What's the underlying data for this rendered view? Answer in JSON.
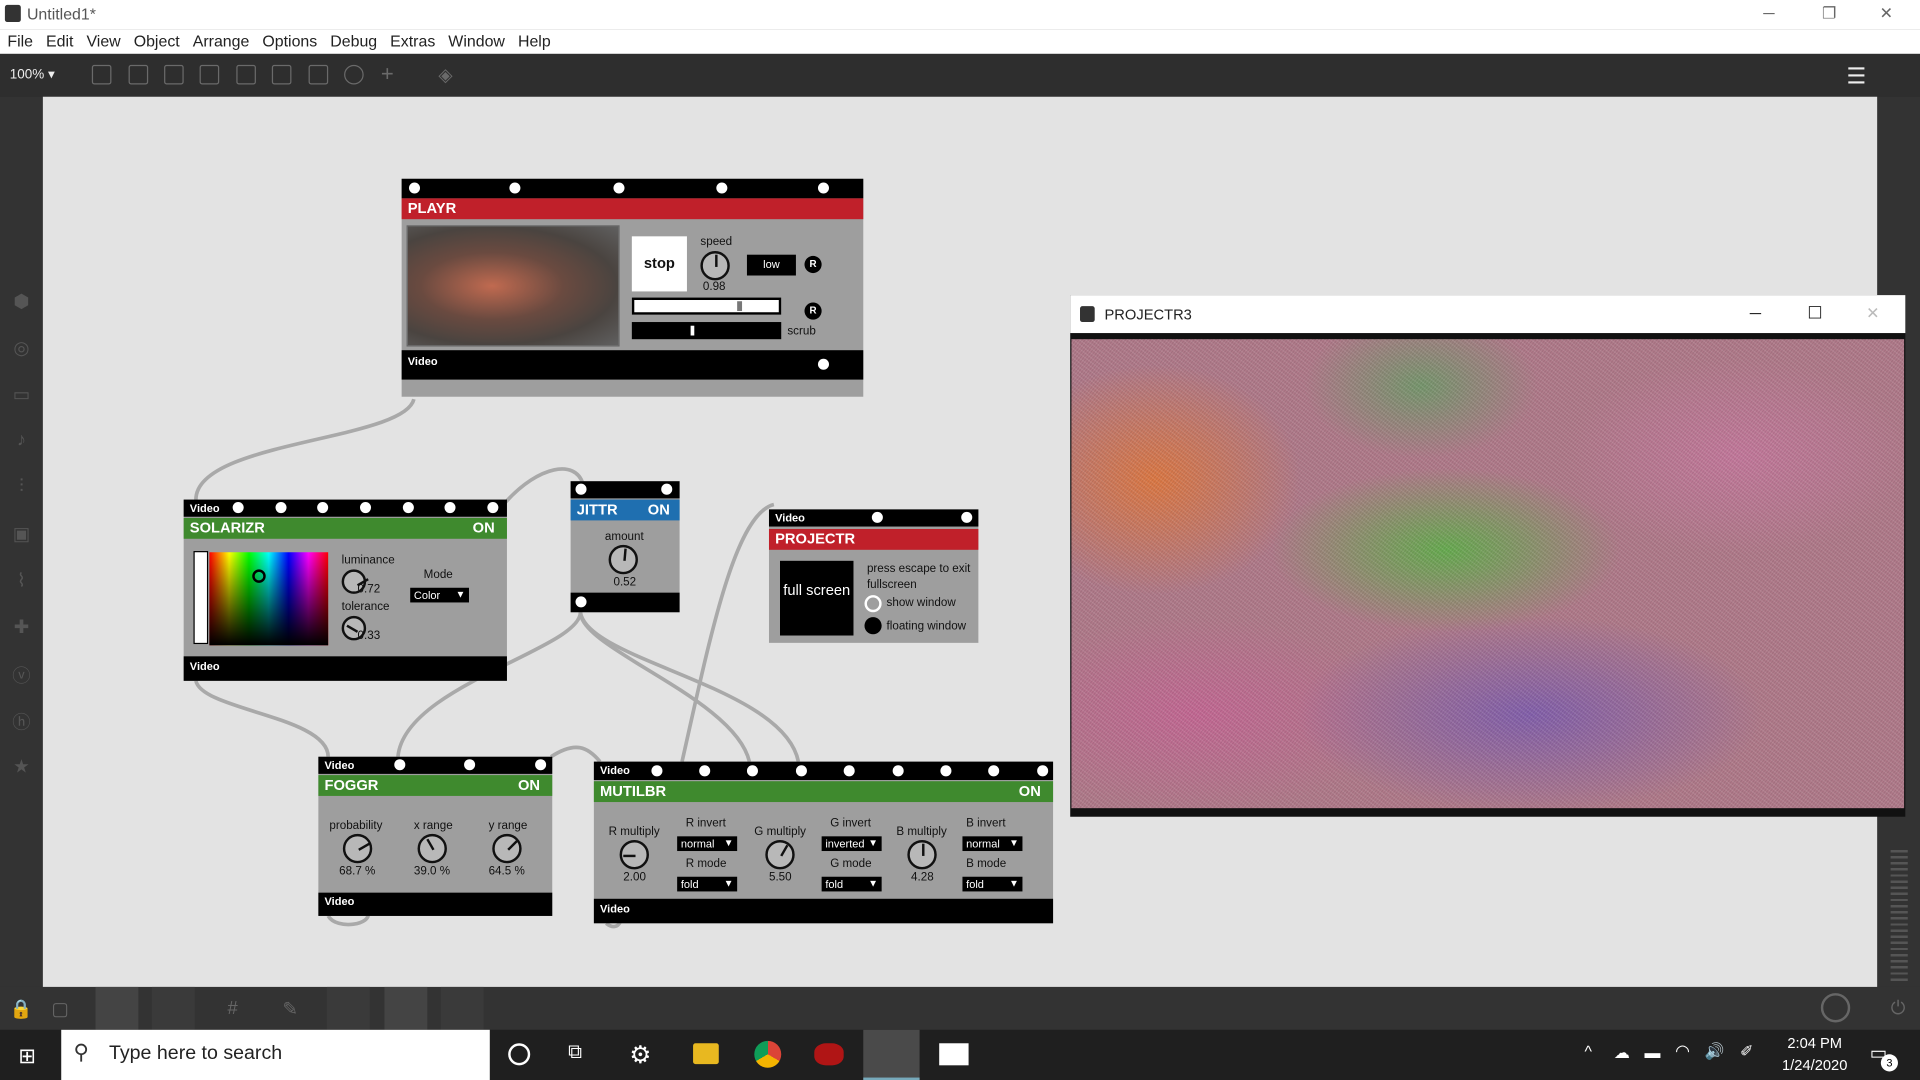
{
  "window": {
    "title": "Untitled1*",
    "minimize": "─",
    "restore": "❐",
    "close": "✕"
  },
  "menu": [
    "File",
    "Edit",
    "View",
    "Object",
    "Arrange",
    "Options",
    "Debug",
    "Extras",
    "Window",
    "Help"
  ],
  "toolbar": {
    "zoom": "100% ▾"
  },
  "playr": {
    "title": "PLAYR",
    "stop_label": "stop",
    "speed_label": "speed",
    "speed_value": "0.98",
    "speed_knob": 0.49,
    "quality_label": "low",
    "reset_label": "R",
    "scrub_label": "scrub",
    "out_label": "Video"
  },
  "solarizr": {
    "in_label": "Video",
    "title": "SOLARIZR",
    "state": "ON",
    "luminance_label": "luminance",
    "luminance_value": "0.72",
    "tolerance_label": "tolerance",
    "tolerance_value": "0.33",
    "mode_label": "Mode",
    "mode_value": "Color",
    "out_label": "Video"
  },
  "jittr": {
    "title": "JITTR",
    "state": "ON",
    "amount_label": "amount",
    "amount_value": "0.52"
  },
  "projectr": {
    "in_label": "Video",
    "title": "PROJECTR",
    "fullscreen_label": "full screen",
    "escape_text": "press escape to exit fullscreen",
    "show_window_label": "show window",
    "floating_window_label": "floating window"
  },
  "foggr": {
    "in_label": "Video",
    "title": "FOGGR",
    "state": "ON",
    "probability_label": "probability",
    "probability_value": "68.7 %",
    "xrange_label": "x range",
    "xrange_value": "39.0 %",
    "yrange_label": "y range",
    "yrange_value": "64.5 %",
    "out_label": "Video"
  },
  "mutilbr": {
    "in_label": "Video",
    "title": "MUTILBR",
    "state": "ON",
    "r_multiply_label": "R multiply",
    "r_multiply_value": "2.00",
    "r_invert_label": "R invert",
    "r_invert_value": "normal",
    "r_mode_label": "R mode",
    "r_mode_value": "fold",
    "g_multiply_label": "G multiply",
    "g_multiply_value": "5.50",
    "g_invert_label": "G invert",
    "g_invert_value": "inverted",
    "g_mode_label": "G mode",
    "g_mode_value": "fold",
    "b_multiply_label": "B multiply",
    "b_multiply_value": "4.28",
    "b_invert_label": "B invert",
    "b_invert_value": "normal",
    "b_mode_label": "B mode",
    "b_mode_value": "fold",
    "out_label": "Video"
  },
  "projector_window": {
    "title": "PROJECTR3",
    "minimize": "─",
    "maximize": "☐",
    "close": "✕"
  },
  "taskbar": {
    "search_placeholder": "Type here to search",
    "time": "2:04 PM",
    "date": "1/24/2020",
    "notifications": "3"
  },
  "colors": {
    "red_header": "#c0202a",
    "green_header": "#3f8a2e",
    "blue_header": "#1f6fb0"
  }
}
